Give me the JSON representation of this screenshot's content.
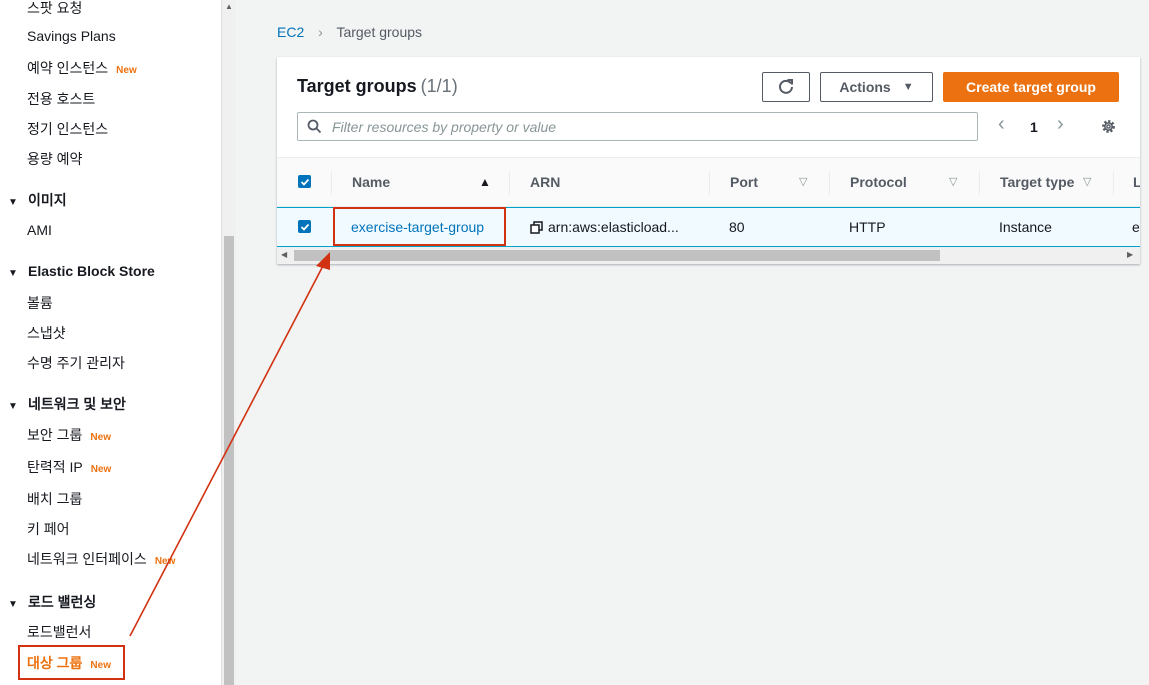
{
  "sidebar": {
    "items": [
      {
        "label": "스팟 요청",
        "new": ""
      },
      {
        "label": "Savings Plans",
        "new": ""
      },
      {
        "label": "예약 인스턴스",
        "new": "New"
      },
      {
        "label": "전용 호스트",
        "new": ""
      },
      {
        "label": "정기 인스턴스",
        "new": ""
      },
      {
        "label": "용량 예약",
        "new": ""
      }
    ],
    "sections": [
      {
        "title": "이미지",
        "items": [
          {
            "label": "AMI",
            "new": ""
          }
        ]
      },
      {
        "title": "Elastic Block Store",
        "items": [
          {
            "label": "볼륨",
            "new": ""
          },
          {
            "label": "스냅샷",
            "new": ""
          },
          {
            "label": "수명 주기 관리자",
            "new": ""
          }
        ]
      },
      {
        "title": "네트워크 및 보안",
        "items": [
          {
            "label": "보안 그룹",
            "new": "New"
          },
          {
            "label": "탄력적 IP",
            "new": "New"
          },
          {
            "label": "배치 그룹",
            "new": ""
          },
          {
            "label": "키 페어",
            "new": ""
          },
          {
            "label": "네트워크 인터페이스",
            "new": "New"
          }
        ]
      },
      {
        "title": "로드 밸런싱",
        "items": [
          {
            "label": "로드밸런서",
            "new": ""
          },
          {
            "label": "대상 그룹",
            "new": "New"
          }
        ]
      }
    ]
  },
  "breadcrumb": {
    "root": "EC2",
    "current": "Target groups"
  },
  "panel": {
    "title": "Target groups",
    "count": "(1/1)",
    "refresh_icon": "refresh-icon",
    "actions_label": "Actions",
    "create_label": "Create target group",
    "filter_placeholder": "Filter resources by property or value",
    "page": "1"
  },
  "table": {
    "headers": [
      "Name",
      "ARN",
      "Port",
      "Protocol",
      "Target type",
      "L"
    ],
    "rows": [
      {
        "name": "exercise-target-group",
        "arn": "arn:aws:elasticload...",
        "port": "80",
        "protocol": "HTTP",
        "target_type": "Instance",
        "extra": "e"
      }
    ]
  },
  "colors": {
    "accent": "#ec7211",
    "link": "#0073bb",
    "annotation": "#d13212"
  }
}
